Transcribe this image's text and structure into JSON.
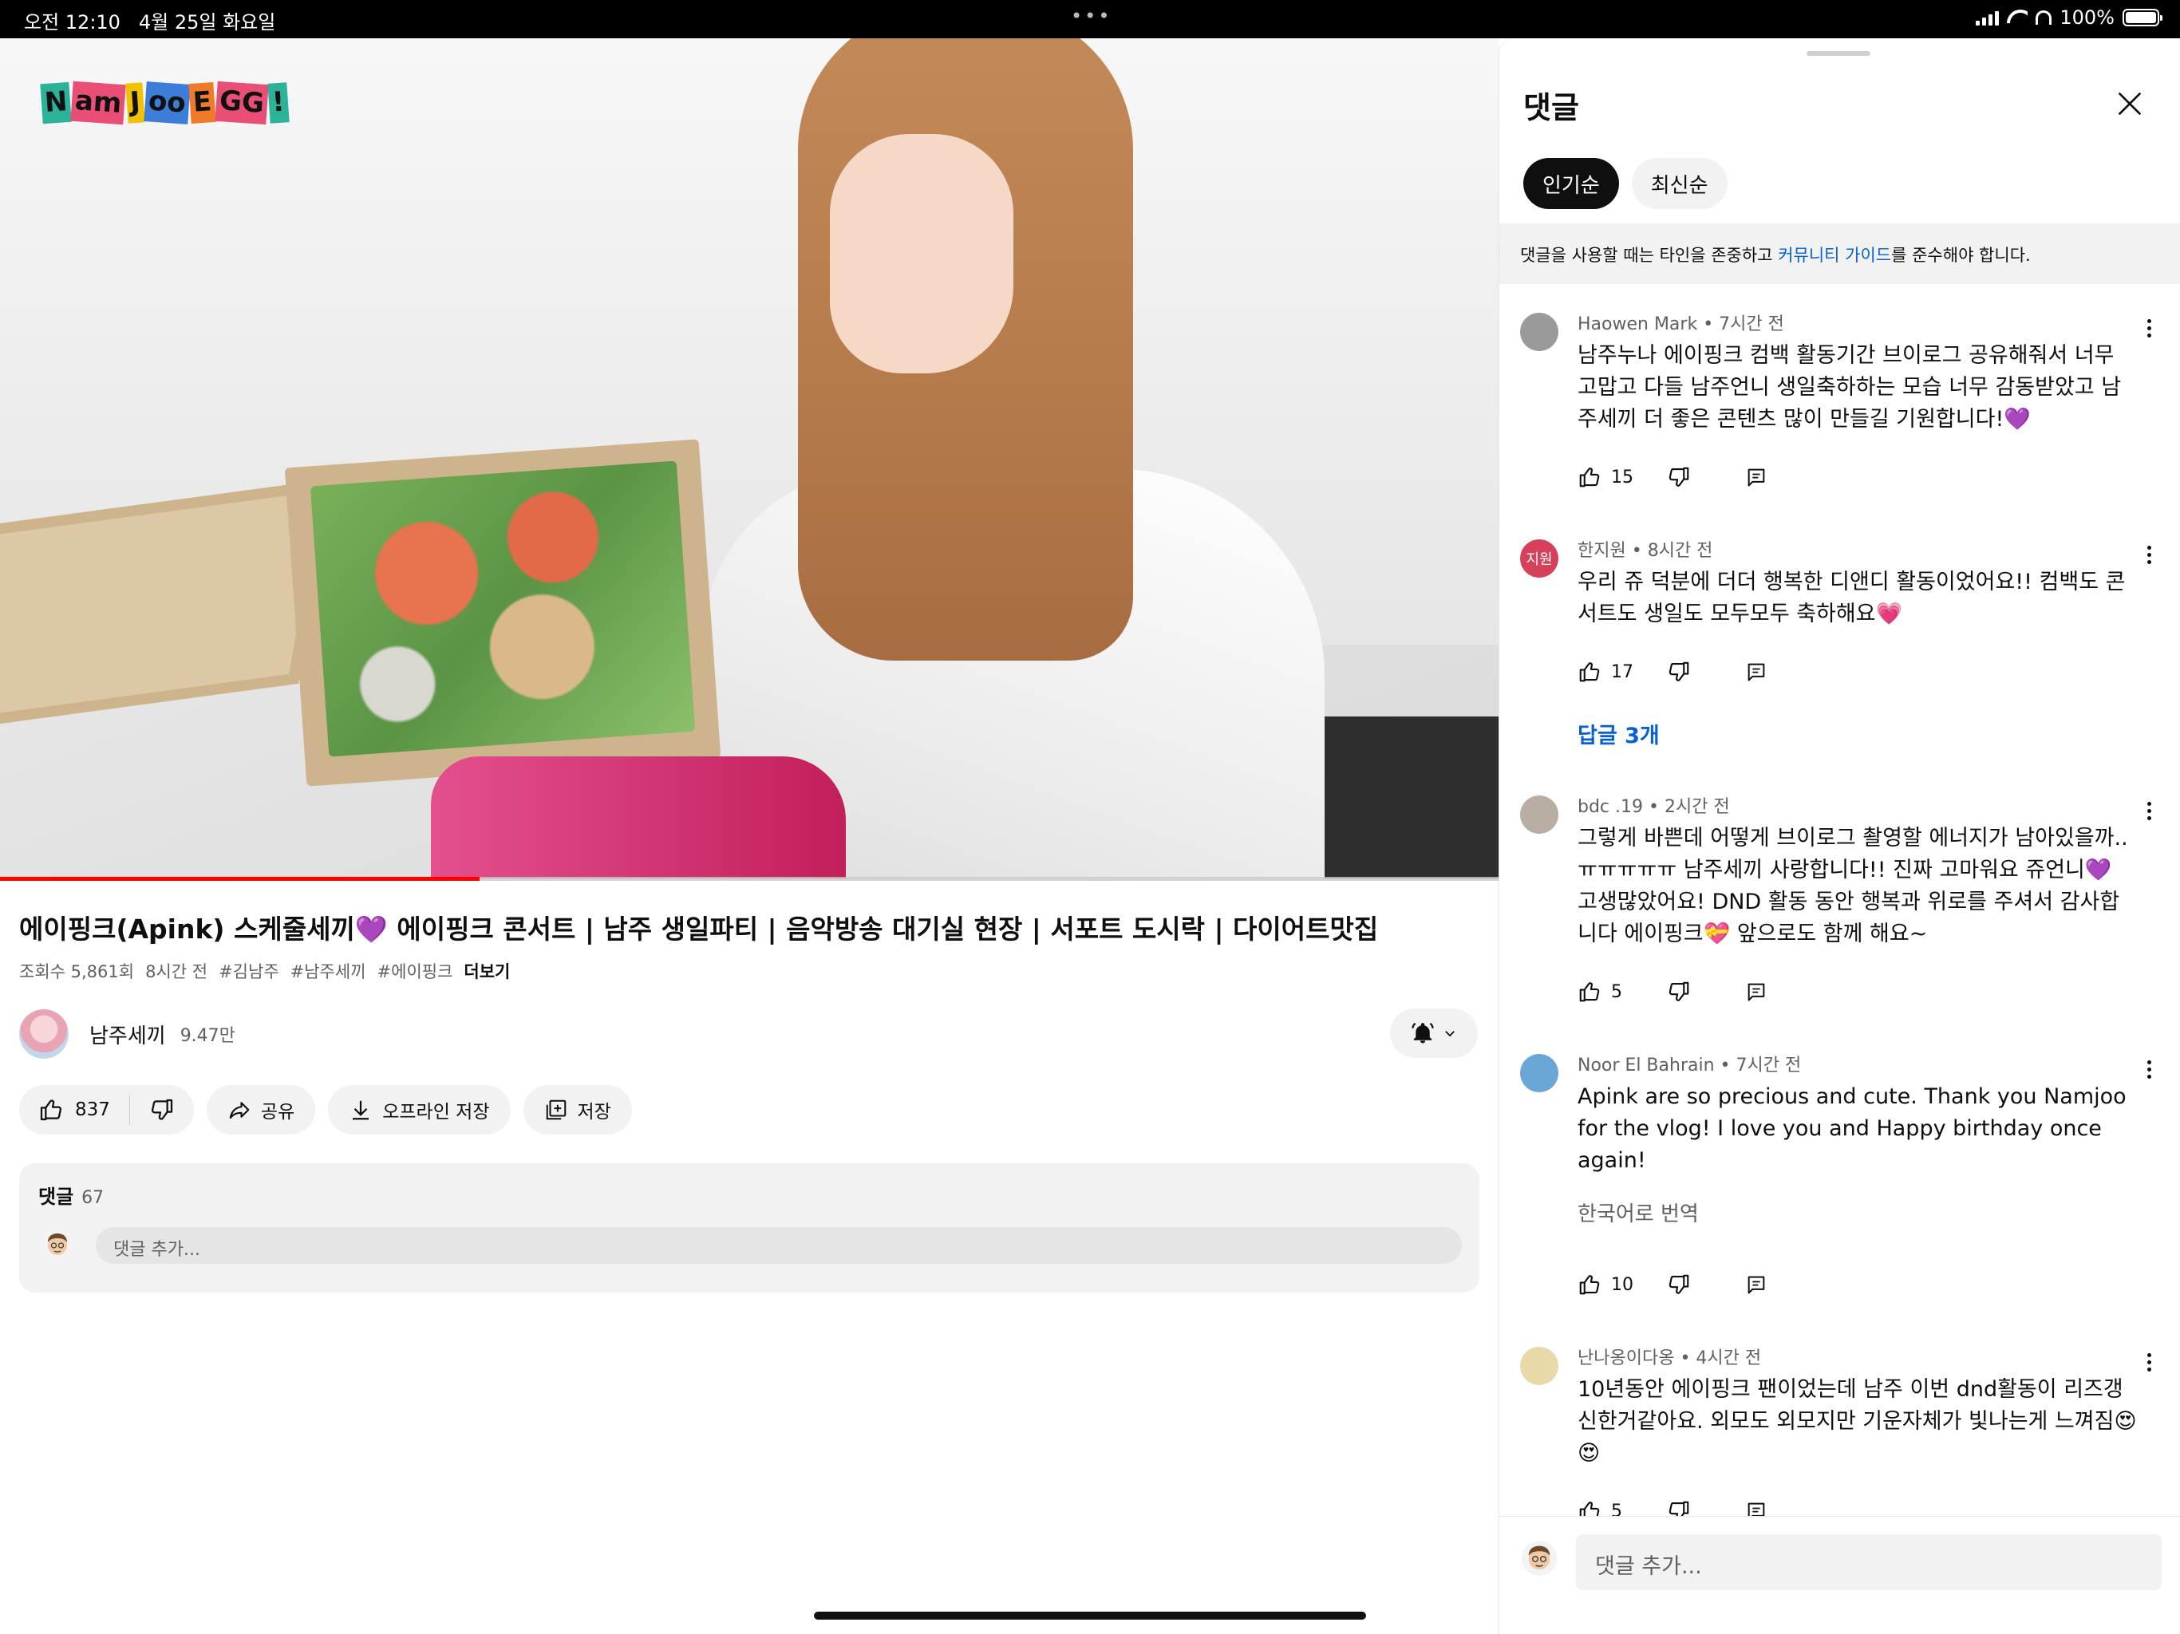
{
  "status_bar": {
    "time": "오전 12:10",
    "date": "4월 25일 화요일",
    "battery": "100%"
  },
  "video": {
    "logo": [
      "N",
      "am",
      "J",
      "oo",
      "E",
      "GG",
      "!"
    ],
    "logo_colors": [
      "#2bb39a",
      "#e94e77",
      "#f2c200",
      "#3b7dd8",
      "#f07a2a",
      "#e94e77",
      "#2bb39a"
    ],
    "progress": 0.32,
    "title": "에이핑크(Apink) 스케줄세끼💜 에이핑크 콘서트 | 남주 생일파티 | 음악방송 대기실 현장 | 서포트 도시락 | 다이어트맛집",
    "views": "조회수 5,861회",
    "age": "8시간 전",
    "tags": [
      "#김남주",
      "#남주세끼",
      "#에이핑크"
    ],
    "more": "더보기"
  },
  "channel": {
    "name": "남주세끼",
    "subscribers": "9.47만"
  },
  "actions": {
    "likes": "837",
    "share": "공유",
    "download": "오프라인 저장",
    "save": "저장"
  },
  "comments_card": {
    "label": "댓글",
    "count": "67",
    "placeholder": "댓글 추가..."
  },
  "panel": {
    "title": "댓글",
    "chips": [
      "인기순",
      "최신순"
    ],
    "guide_before": "댓글을 사용할 때는 타인을 존중하고 ",
    "guide_link": "커뮤니티 가이드",
    "guide_after": "를 준수해야 합니다.",
    "comments": [
      {
        "author": "Haowen Mark",
        "time": "7시간 전",
        "text": "남주누나 에이핑크 컴백 활동기간 브이로그 공유해줘서 너무 고맙고 다들 남주언니 생일축하하는 모습 너무 감동받았고 남주세끼 더 좋은 콘텐츠 많이 만들길 기원합니다!💜",
        "likes": "15",
        "avatar_text": "",
        "avatar_color": "#9a9a9a"
      },
      {
        "author": "한지원",
        "time": "8시간 전",
        "text": "우리 쥬 덕분에 더더 행복한 디앤디 활동이었어요!! 컴백도 콘서트도 생일도 모두모두 축하해요💗",
        "likes": "17",
        "avatar_text": "지원",
        "avatar_color": "#d6405a",
        "replies": "답글 3개"
      },
      {
        "author": "bdc .19",
        "time": "2시간 전",
        "text": "그렇게 바쁜데 어떻게 브이로그 촬영할 에너지가 남아있을까..ㅠㅠㅠㅠㅠ 남주세끼 사랑합니다!! 진짜 고마워요 쥬언니💜 고생많았어요! DND 활동 동안 행복과 위로를 주셔서 감사합니다 에이핑크💝 앞으로도 함께 해요~",
        "likes": "5",
        "avatar_text": "",
        "avatar_color": "#b8aea3"
      },
      {
        "author": "Noor El Bahrain",
        "time": "7시간 전",
        "text": "Apink are so precious and cute. Thank you Namjoo for the vlog! I love you and Happy birthday once again!",
        "likes": "10",
        "avatar_text": "",
        "avatar_color": "#6aa6d8",
        "translate": "한국어로 번역"
      },
      {
        "author": "난나옹이다옹",
        "time": "4시간 전",
        "text": "10년동안 에이핑크 팬이었는데 남주 이번 dnd활동이 리즈갱신한거같아요. 외모도 외모지만 기운자체가 빛나는게 느껴짐😍😍",
        "likes": "5",
        "avatar_text": "",
        "avatar_color": "#e8d9a8"
      }
    ],
    "bottom_placeholder": "댓글 추가..."
  }
}
